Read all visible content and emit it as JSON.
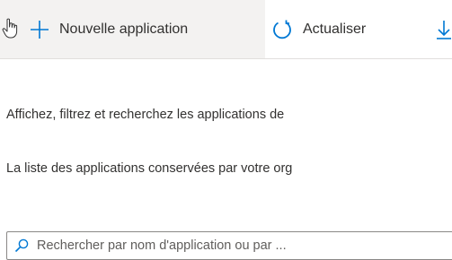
{
  "toolbar": {
    "new_app_label": "Nouvelle application",
    "refresh_label": "Actualiser",
    "accent_color": "#0078d4"
  },
  "content": {
    "description": "Affichez, filtrez et recherchez les applications de",
    "retention_note": "La liste des applications conservées par votre org"
  },
  "search": {
    "placeholder": "Rechercher par nom d'application ou par ..."
  },
  "icons": {
    "new_app": "plus-icon",
    "refresh": "refresh-icon",
    "download": "download-icon",
    "search": "search-icon",
    "cursor": "hand-cursor-icon"
  }
}
